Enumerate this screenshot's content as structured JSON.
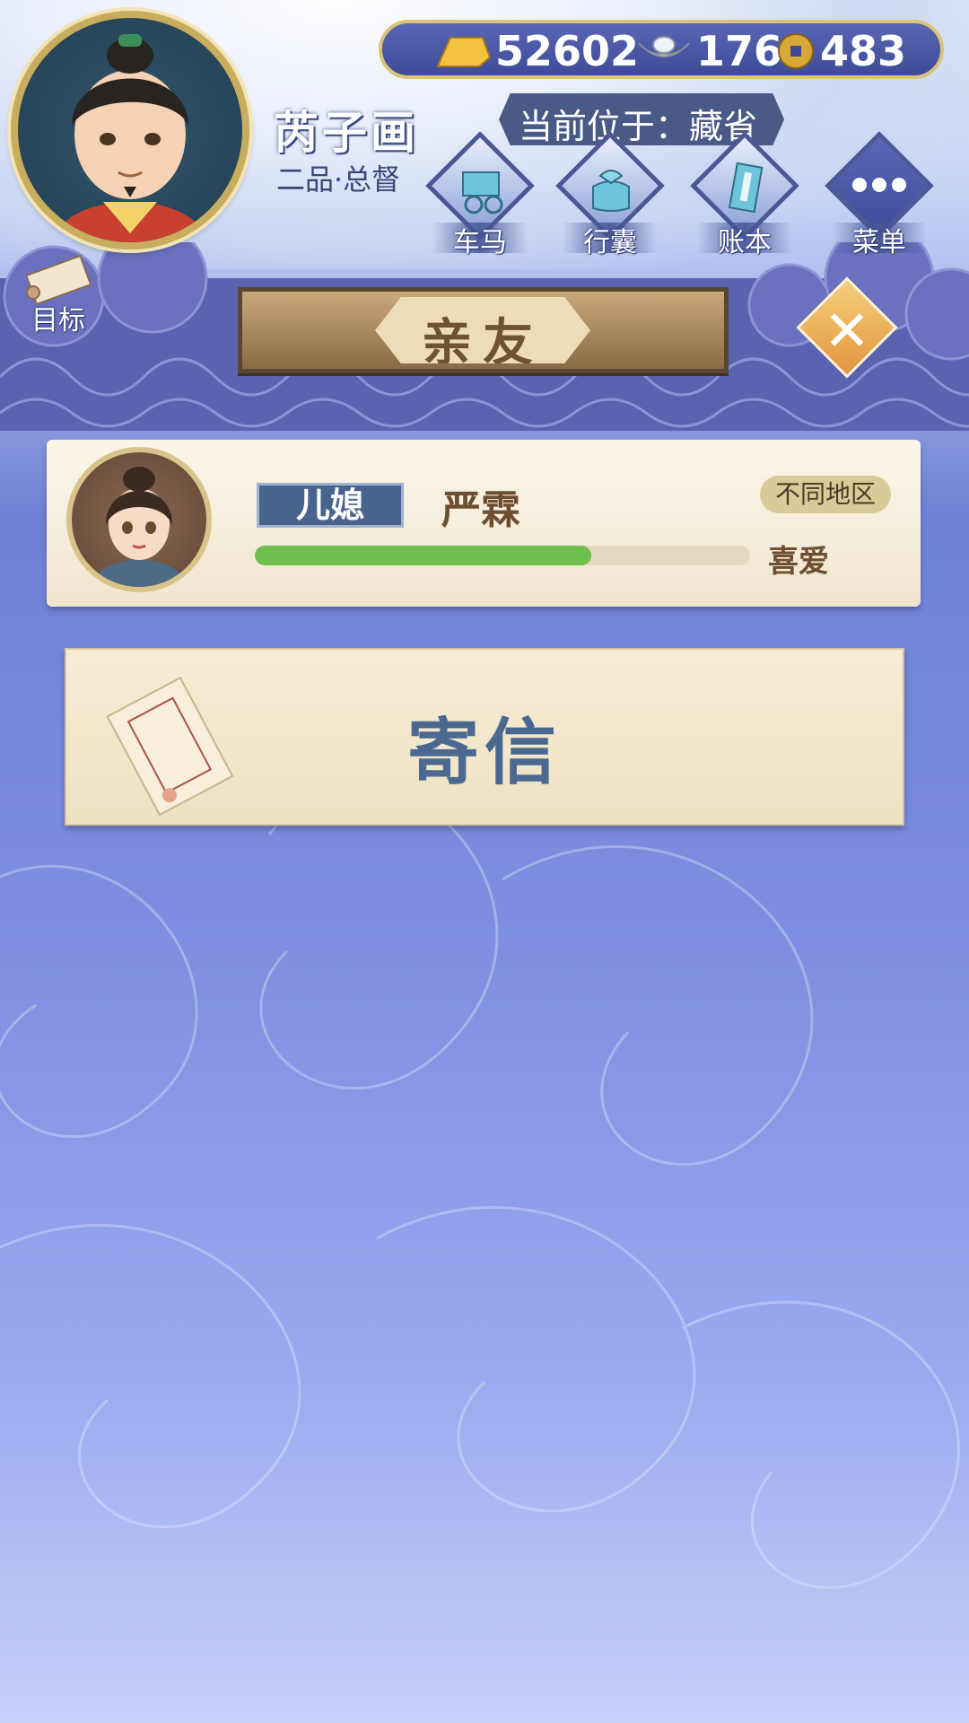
{
  "header": {
    "player_name": "芮子画",
    "player_rank": "二品·总督",
    "currency": {
      "gold": "52602",
      "silver": "176",
      "coins": "483"
    },
    "location_label": "当前位于：藏省",
    "nav": [
      {
        "label": "车马",
        "icon": "carriage-icon"
      },
      {
        "label": "行囊",
        "icon": "bag-icon"
      },
      {
        "label": "账本",
        "icon": "ledger-icon"
      },
      {
        "label": "菜单",
        "icon": "menu-dots-icon"
      }
    ],
    "goal_label": "目标"
  },
  "panel": {
    "title": "亲友",
    "relative": {
      "role": "儿媳",
      "name": "严霖",
      "region_badge": "不同地区",
      "affection_progress": 0.68,
      "affection_level": "喜爱"
    },
    "send_letter_label": "寄信"
  },
  "colors": {
    "accent_blue": "#4b6990",
    "progress_green": "#6fbf4f",
    "banner_brown": "#8a6a46",
    "close_orange": "#e2953f"
  }
}
